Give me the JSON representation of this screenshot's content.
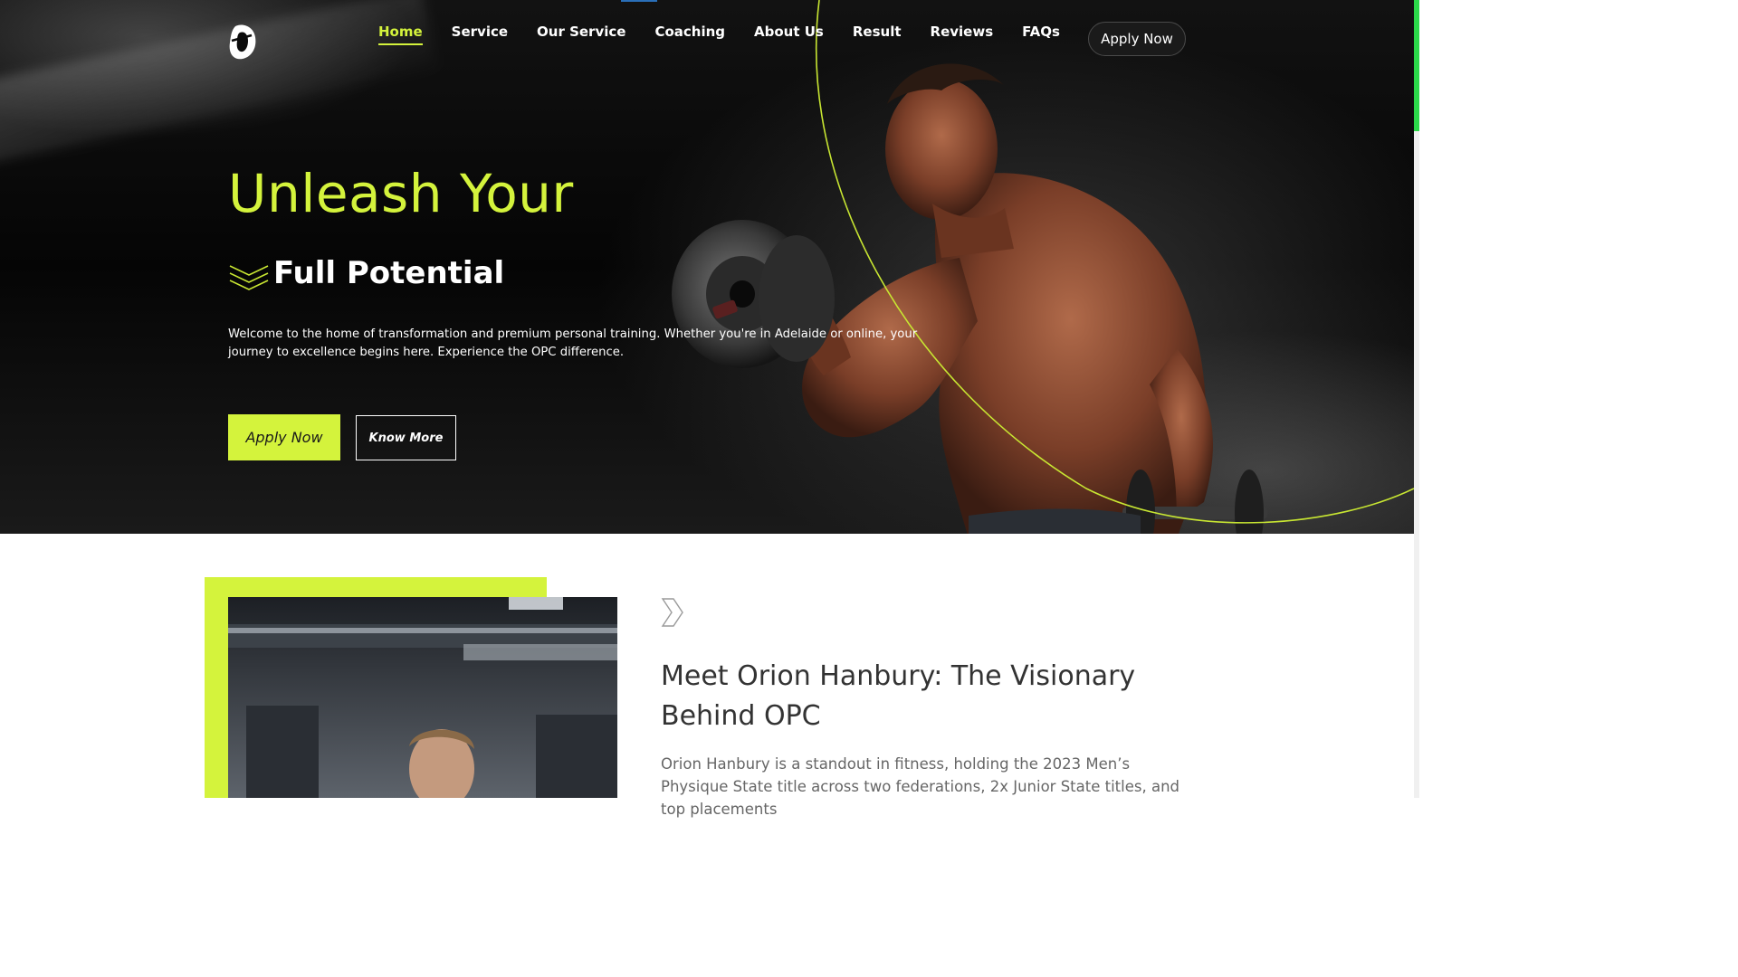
{
  "header": {
    "nav": [
      {
        "label": "Home",
        "active": true
      },
      {
        "label": "Service",
        "active": false
      },
      {
        "label": "Our Service",
        "active": false
      },
      {
        "label": "Coaching",
        "active": false
      },
      {
        "label": "About Us",
        "active": false
      },
      {
        "label": "Result",
        "active": false
      },
      {
        "label": "Reviews",
        "active": false
      },
      {
        "label": "FAQs",
        "active": false
      }
    ],
    "apply_label": "Apply Now"
  },
  "hero": {
    "title": "Unleash Your",
    "subtitle": "Full Potential",
    "description": "Welcome to the home of transformation and premium personal training. Whether you're in Adelaide or online, your journey to excellence begins here. Experience the OPC difference.",
    "apply_label": "Apply Now",
    "know_more_label": "Know More"
  },
  "about": {
    "heading": "Meet Orion Hanbury: The Visionary Behind OPC",
    "body": "Orion Hanbury is a standout in fitness, holding the 2023 Men’s Physique State title across two federations, 2x Junior State titles, and top placements"
  },
  "colors": {
    "accent": "#d4f33c",
    "hero_bg": "#0a0a0a",
    "text_dark": "#333333",
    "text_muted": "#666666"
  },
  "icons": {
    "logo": "opc-logo-icon",
    "chevrons": "triple-chevron-icon",
    "section_marker": "chevron-right-outline-icon"
  }
}
